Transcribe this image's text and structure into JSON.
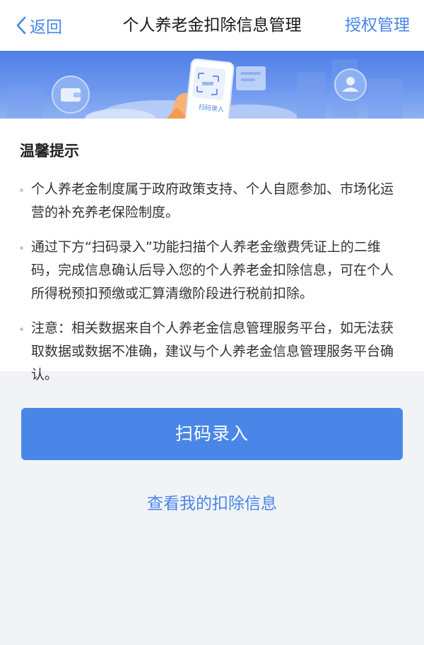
{
  "nav": {
    "back_label": "返回",
    "title": "个人养老金扣除信息管理",
    "right_label": "授权管理"
  },
  "banner": {
    "phone_label": "扫码录入"
  },
  "tips": {
    "title": "温馨提示",
    "items": [
      "个人养老金制度属于政府政策支持、个人自愿参加、市场化运营的补充养老保险制度。",
      "通过下方“扫码录入”功能扫描个人养老金缴费凭证上的二维码，完成信息确认后导入您的个人养老金扣除信息，可在个人所得税预扣预缴或汇算清缴阶段进行税前扣除。",
      "注意：相关数据来自个人养老金信息管理服务平台，如无法获取数据或数据不准确，建议与个人养老金信息管理服务平台确认。"
    ]
  },
  "actions": {
    "scan_button": "扫码录入",
    "view_link": "查看我的扣除信息"
  },
  "colors": {
    "accent": "#4a86e8",
    "background": "#f2f3f7"
  }
}
